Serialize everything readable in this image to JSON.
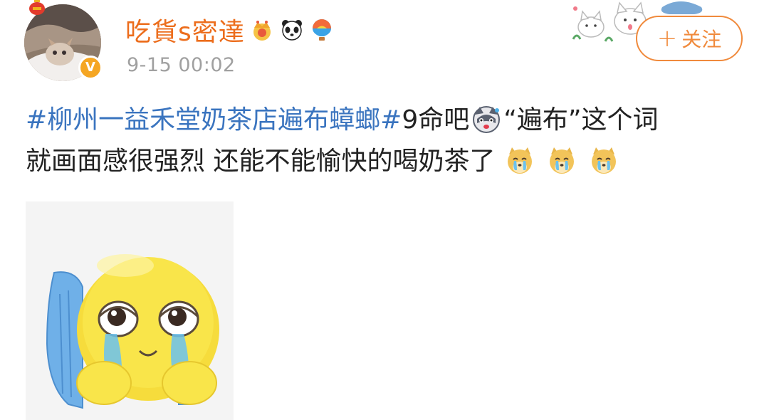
{
  "user": {
    "name": "吃貨s密達",
    "badges": [
      "crown-badge-icon",
      "panda-badge-icon",
      "hot-air-balloon-badge-icon"
    ],
    "verified": true
  },
  "post": {
    "timestamp": "9-15 00:02",
    "hashtag_1": "#柳州一益禾堂奶茶店遍布蟑螂#",
    "text_1": "9命吧",
    "emoji_1": "husky-dog-emoji",
    "text_2": "“遍布”这个词",
    "text_3": "就画面感很强烈 还能不能愉快的喝奶茶了",
    "emoji_trailing": [
      "crying-doge-emoji",
      "crying-doge-emoji",
      "crying-doge-emoji"
    ],
    "image": "crying-emoji-sticker"
  },
  "actions": {
    "follow_plus": "+",
    "follow_label": "关注"
  },
  "colors": {
    "username": "#ec6d1c",
    "hashtag": "#3a74bf",
    "follow_border": "#f08a3c",
    "timestamp": "#a0a0a0"
  }
}
